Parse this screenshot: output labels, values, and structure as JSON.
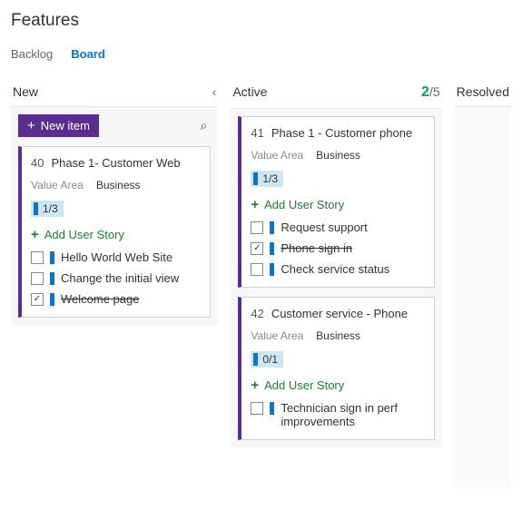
{
  "page_title": "Features",
  "tabs": {
    "backlog": "Backlog",
    "board": "Board"
  },
  "columns": {
    "new": {
      "title": "New"
    },
    "active": {
      "title": "Active",
      "wip_count": "2",
      "wip_limit": "/5"
    },
    "resolved": {
      "title": "Resolved"
    }
  },
  "newitem_label": "New item",
  "field_label_value_area": "Value Area",
  "add_user_story_label": "Add User Story",
  "cards_new": [
    {
      "id": "40",
      "title": "Phase 1- Customer Web",
      "value_area": "Business",
      "progress": "1/3",
      "stories": [
        {
          "label": "Hello World Web Site",
          "done": false
        },
        {
          "label": "Change the initial view",
          "done": false
        },
        {
          "label": "Welcome page",
          "done": true
        }
      ]
    }
  ],
  "cards_active": [
    {
      "id": "41",
      "title": "Phase 1 - Customer phone",
      "value_area": "Business",
      "progress": "1/3",
      "stories": [
        {
          "label": "Request support",
          "done": false
        },
        {
          "label": "Phone sign in",
          "done": true
        },
        {
          "label": "Check service status",
          "done": false
        }
      ]
    },
    {
      "id": "42",
      "title": "Customer service - Phone",
      "value_area": "Business",
      "progress": "0/1",
      "stories": [
        {
          "label": "Technician sign in perf improvements",
          "done": false
        }
      ]
    }
  ]
}
